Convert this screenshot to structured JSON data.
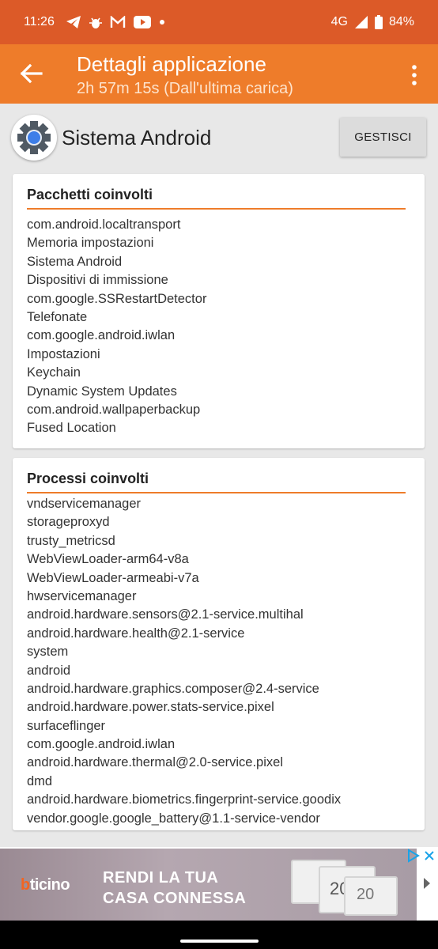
{
  "status": {
    "time": "11:26",
    "network": "4G",
    "battery": "84%",
    "icons": [
      "telegram-icon",
      "bug-icon",
      "gmail-icon",
      "youtube-icon",
      "dot-icon",
      "signal-icon",
      "battery-icon"
    ]
  },
  "appbar": {
    "title": "Dettagli applicazione",
    "subtitle": "2h 57m 15s (Dall'ultima carica)"
  },
  "app": {
    "name": "Sistema Android",
    "manage_label": "GESTISCI"
  },
  "packages": {
    "title": "Pacchetti coinvolti",
    "items": [
      "com.android.localtransport",
      "Memoria impostazioni",
      "Sistema Android",
      "Dispositivi di immissione",
      "com.google.SSRestartDetector",
      "Telefonate",
      "com.google.android.iwlan",
      "Impostazioni",
      "Keychain",
      "Dynamic System Updates",
      "com.android.wallpaperbackup",
      "Fused Location"
    ]
  },
  "processes": {
    "title": "Processi coinvolti",
    "items": [
      "vndservicemanager",
      "storageproxyd",
      "trusty_metricsd",
      "WebViewLoader-arm64-v8a",
      "WebViewLoader-armeabi-v7a",
      "hwservicemanager",
      "android.hardware.sensors@2.1-service.multihal",
      "android.hardware.health@2.1-service",
      "system",
      "android",
      "android.hardware.graphics.composer@2.4-service",
      "android.hardware.power.stats-service.pixel",
      "surfaceflinger",
      "com.google.android.iwlan",
      "android.hardware.thermal@2.0-service.pixel",
      "dmd",
      "android.hardware.biometrics.fingerprint-service.goodix",
      "vendor.google.google_battery@1.1-service-vendor"
    ]
  },
  "ad": {
    "logo_prefix": "b",
    "logo_rest": "ticino",
    "headline_1": "RENDI LA TUA",
    "headline_2": "CASA CONNESSA",
    "device_text": "20"
  },
  "colors": {
    "status_bar": "#dc5a28",
    "app_bar": "#ee7c2a",
    "accent_rule": "#ee7c2a"
  }
}
